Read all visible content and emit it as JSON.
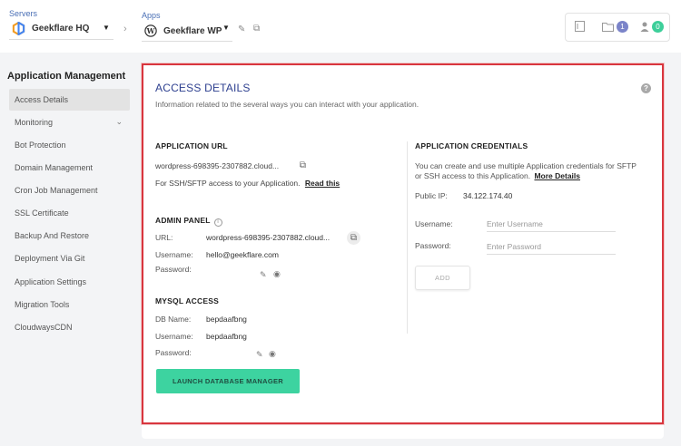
{
  "header": {
    "servers_label": "Servers",
    "server_name": "Geekflare HQ",
    "apps_label": "Apps",
    "app_name": "Geekflare WP",
    "files_count": "1",
    "users_count": "0",
    "colors": {
      "files_badge": "#7b84c9",
      "users_badge": "#3dcf9a"
    }
  },
  "sidebar": {
    "title": "Application Management",
    "items": [
      {
        "label": "Access Details",
        "active": true
      },
      {
        "label": "Monitoring",
        "has_chevron": true
      },
      {
        "label": "Bot Protection"
      },
      {
        "label": "Domain Management"
      },
      {
        "label": "Cron Job Management"
      },
      {
        "label": "SSL Certificate"
      },
      {
        "label": "Backup And Restore"
      },
      {
        "label": "Deployment Via Git"
      },
      {
        "label": "Application Settings"
      },
      {
        "label": "Migration Tools"
      },
      {
        "label": "CloudwaysCDN"
      }
    ]
  },
  "panel": {
    "title": "ACCESS DETAILS",
    "subtitle": "Information related to the several ways you can interact with your application.",
    "app_url": {
      "heading": "APPLICATION URL",
      "url": "wordpress-698395-2307882.cloud...",
      "ssh_note": "For SSH/SFTP access to your Application.",
      "read_this": "Read this"
    },
    "admin_panel": {
      "heading": "ADMIN PANEL",
      "url_label": "URL:",
      "url_value": "wordpress-698395-2307882.cloud...",
      "username_label": "Username:",
      "username_value": "hello@geekflare.com",
      "password_label": "Password:"
    },
    "mysql": {
      "heading": "MYSQL ACCESS",
      "db_label": "DB Name:",
      "db_value": "bepdaafbng",
      "username_label": "Username:",
      "username_value": "bepdaafbng",
      "password_label": "Password:",
      "launch_button": "LAUNCH DATABASE MANAGER"
    },
    "credentials": {
      "heading": "APPLICATION CREDENTIALS",
      "desc_line1": "You can create and use multiple Application credentials for SFTP",
      "desc_line2": "or SSH access to this Application.",
      "more_details": "More Details",
      "public_ip_label": "Public IP:",
      "public_ip_value": "34.122.174.40",
      "username_label": "Username:",
      "username_placeholder": "Enter Username",
      "password_label": "Password:",
      "password_placeholder": "Enter Password",
      "add_button": "ADD"
    },
    "accent_color": "#d9363e",
    "launch_color": "#3dd3a0"
  }
}
